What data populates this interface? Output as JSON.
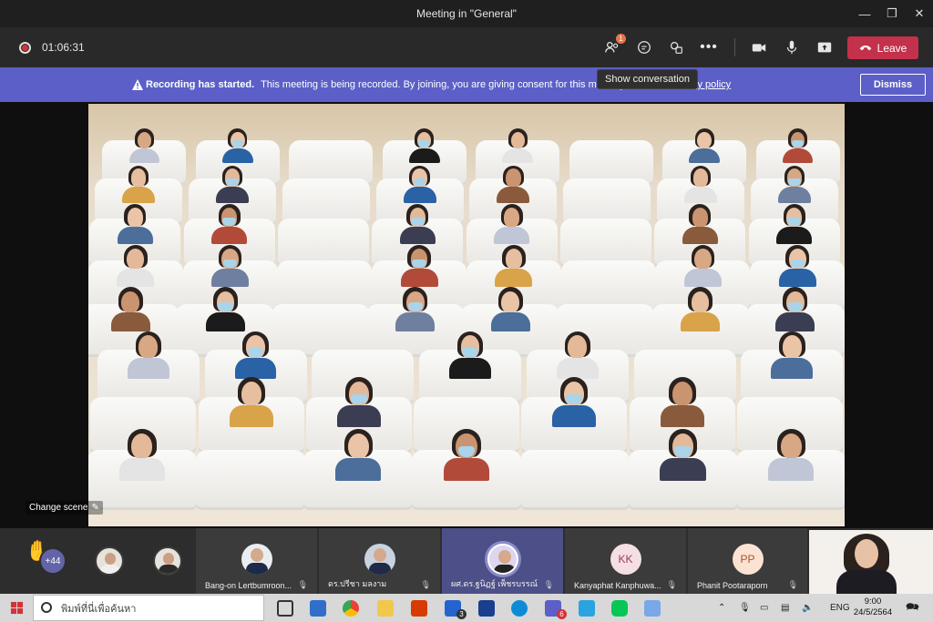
{
  "window": {
    "title": "Meeting in \"General\""
  },
  "toolbar": {
    "timer": "01:06:31",
    "participants_badge": "1",
    "leave_label": "Leave",
    "tooltip": "Show conversation"
  },
  "banner": {
    "bold": "Recording has started.",
    "message": "This meeting is being recorded. By joining, you are giving consent for this meeting",
    "policy": "cy policy",
    "dismiss": "Dismiss"
  },
  "stage": {
    "change_scene": "Change scene"
  },
  "strip": {
    "more_count": "+44",
    "tiles": [
      {
        "name": "Bang-on Lertbumroon...",
        "initials": ""
      },
      {
        "name": "ดร.ปรีชา มลงาม",
        "initials": ""
      },
      {
        "name": "ผศ.ดร.ฐนิฏฐ์ เพ็ชรบรรณ์",
        "initials": ""
      },
      {
        "name": "Kanyaphat Kanphuwa...",
        "initials": "KK"
      },
      {
        "name": "Phanit Pootaraporn",
        "initials": "PP"
      }
    ]
  },
  "taskbar": {
    "search_placeholder": "พิมพ์ที่นี่เพื่อค้นหา",
    "lang": "ENG",
    "time": "9:00",
    "date": "24/5/2564",
    "notif": "7",
    "task_badge": "3",
    "teams_badge": "6"
  },
  "colors": {
    "accent": "#5b5fc7",
    "leave": "#c4314b",
    "banner": "#5b5fc7"
  }
}
